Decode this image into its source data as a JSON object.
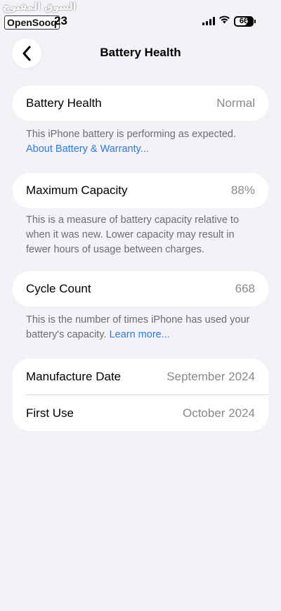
{
  "watermark": {
    "arabic": "السوق المفتوح",
    "latin": "OpenSooq"
  },
  "status_bar": {
    "time": "23",
    "battery_level": "66",
    "battery_fraction": 0.66
  },
  "nav": {
    "title": "Battery Health",
    "back_icon": "chevron-left-icon"
  },
  "health": {
    "label": "Battery Health",
    "value": "Normal",
    "note": "This iPhone battery is performing as expected.",
    "link": "About Battery & Warranty..."
  },
  "capacity": {
    "label": "Maximum Capacity",
    "value": "88%",
    "note": "This is a measure of battery capacity relative to when it was new. Lower capacity may result in fewer hours of usage between charges."
  },
  "cycle": {
    "label": "Cycle Count",
    "value": "668",
    "note": "This is the number of times iPhone has used your battery's capacity.",
    "link": "Learn more..."
  },
  "dates": {
    "manufacture_label": "Manufacture Date",
    "manufacture_value": "September 2024",
    "first_use_label": "First Use",
    "first_use_value": "October 2024"
  },
  "colors": {
    "background": "#f2f2f7",
    "card": "#ffffff",
    "link": "#2f7be0",
    "secondary_text": "#8a8a8e"
  }
}
